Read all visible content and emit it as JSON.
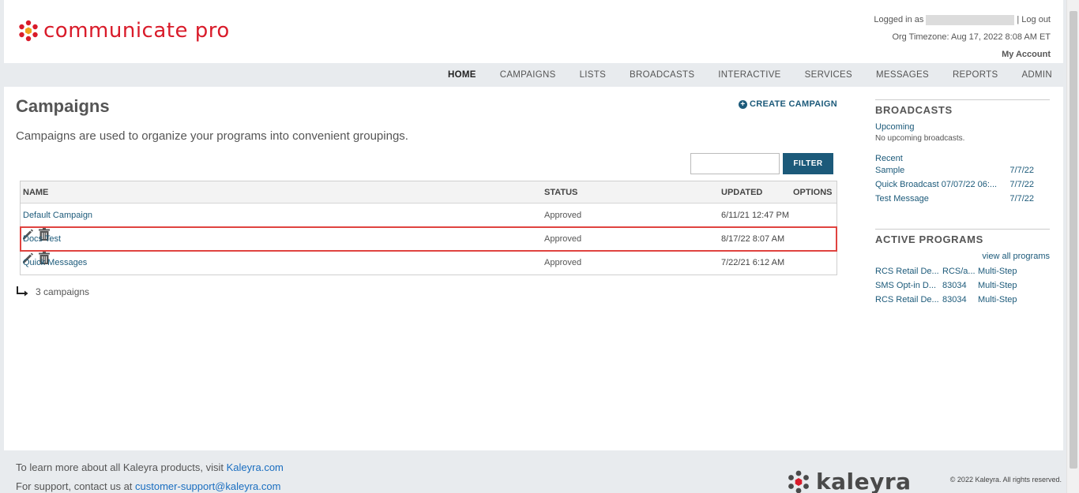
{
  "header": {
    "logo_text": "communicate pro",
    "logged_in_label": "Logged in as",
    "logout": "| Log out",
    "timezone": "Org Timezone: Aug 17, 2022 8:08 AM ET",
    "my_account": "My Account"
  },
  "nav": [
    "HOME",
    "CAMPAIGNS",
    "LISTS",
    "BROADCASTS",
    "INTERACTIVE",
    "SERVICES",
    "MESSAGES",
    "REPORTS",
    "ADMIN"
  ],
  "page": {
    "title": "Campaigns",
    "create_label": "CREATE CAMPAIGN",
    "description": "Campaigns are used to organize your programs into convenient groupings.",
    "filter_value": "",
    "filter_button": "FILTER",
    "count_label": "3 campaigns"
  },
  "table": {
    "columns": [
      "NAME",
      "STATUS",
      "UPDATED",
      "OPTIONS"
    ],
    "rows": [
      {
        "name": "Default Campaign",
        "status": "Approved",
        "updated": "6/11/21 12:47 PM"
      },
      {
        "name": "Docs Test",
        "status": "Approved",
        "updated": "8/17/22 8:07 AM"
      },
      {
        "name": "Quick Messages",
        "status": "Approved",
        "updated": "7/22/21 6:12 AM"
      }
    ]
  },
  "sidebar": {
    "broadcasts": {
      "title": "BROADCASTS",
      "upcoming_label": "Upcoming",
      "upcoming_note": "No upcoming broadcasts.",
      "recent_label": "Recent",
      "recent": [
        {
          "name": "Sample",
          "date": "7/7/22"
        },
        {
          "name": "Quick Broadcast 07/07/22 06:...",
          "date": "7/7/22"
        },
        {
          "name": "Test Message",
          "date": "7/7/22"
        }
      ]
    },
    "active_programs": {
      "title": "ACTIVE PROGRAMS",
      "view_all": "view all programs",
      "items": [
        {
          "name": "RCS Retail De...",
          "code": "RCS/a...",
          "type": "Multi-Step"
        },
        {
          "name": "SMS Opt-in D...",
          "code": "83034",
          "type": "Multi-Step"
        },
        {
          "name": "RCS Retail De...",
          "code": "83034",
          "type": "Multi-Step"
        }
      ]
    }
  },
  "footer": {
    "learn_prefix": "To learn more about all Kaleyra products, visit ",
    "learn_link": "Kaleyra.com",
    "support_prefix": "For support, contact us at ",
    "support_link": "customer-support@kaleyra.com",
    "brand": "kaleyra",
    "copyright": "© 2022 Kaleyra. All rights reserved."
  },
  "colors": {
    "brand_red": "#d91b2a",
    "link_blue": "#1c5a7a",
    "highlight_red": "#e0433f"
  }
}
